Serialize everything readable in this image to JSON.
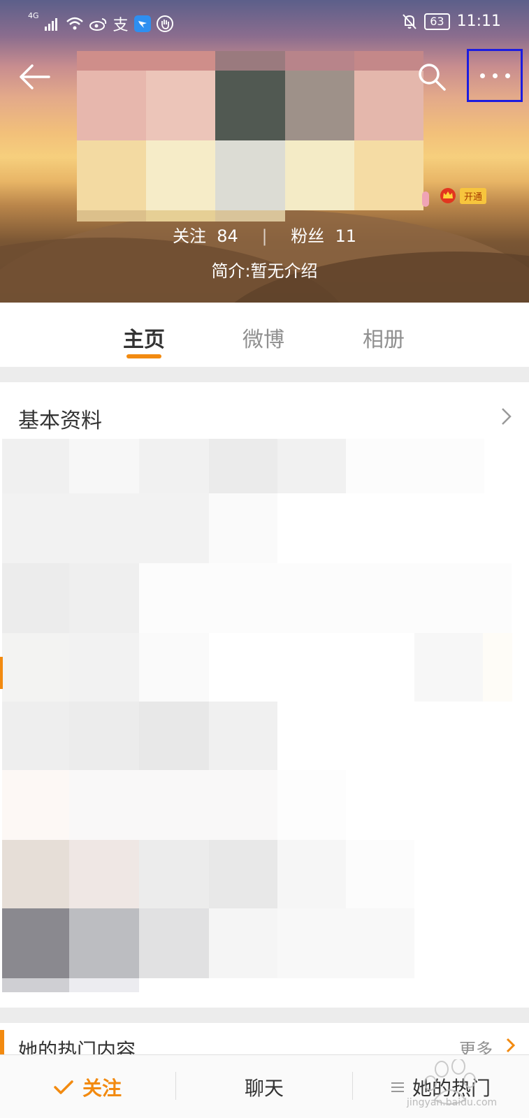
{
  "status_bar": {
    "network": "4G",
    "app_icon_alipay": "支",
    "battery": "63",
    "time": "11:11"
  },
  "profile": {
    "following_label": "关注",
    "following_count": "84",
    "fans_label": "粉丝",
    "fans_count": "11",
    "bio": "简介:暂无介绍",
    "vip_label": "开通"
  },
  "tabs": [
    {
      "label": "主页"
    },
    {
      "label": "微博"
    },
    {
      "label": "相册"
    }
  ],
  "basic_info": {
    "title": "基本资料"
  },
  "hot_content": {
    "title": "她的热门内容",
    "more": "更多"
  },
  "bottom_bar": {
    "follow": "关注",
    "chat": "聊天",
    "hot": "她的热门"
  },
  "watermark": "jingyan.baidu.com",
  "icons": [
    "back-arrow-icon",
    "search-icon",
    "more-dots-icon",
    "crown-icon",
    "chevron-right-icon",
    "check-icon",
    "menu-icon"
  ],
  "colors": {
    "accent": "#f28a10",
    "highlight_box": "#1c1ce0"
  }
}
